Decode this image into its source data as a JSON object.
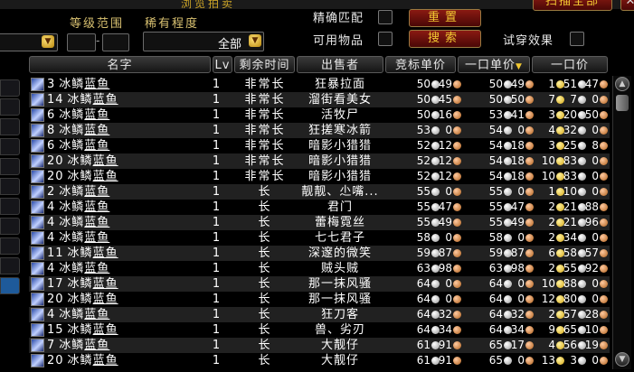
{
  "window": {
    "title": "浏览拍卖",
    "scan_all_label": "扫描全部",
    "close_label": "✕"
  },
  "filters": {
    "level_range_label": "等级范围",
    "rarity_label": "稀有程度",
    "rarity_value": "全部",
    "exact_match_label": "精确匹配",
    "usable_items_label": "可用物品",
    "try_on_label": "试穿效果",
    "reset_label": "重置",
    "search_label": "搜索"
  },
  "columns": {
    "name": "名字",
    "lv": "Lv",
    "time_left": "剩余时间",
    "seller": "出售者",
    "bid_unit": "竞标单价",
    "buyout_unit": "一口单价",
    "buyout": "一口价"
  },
  "item_name_prefix": "冰鳞",
  "item_name_suffix": "蓝鱼",
  "rows": [
    {
      "qty": "3",
      "lv": "1",
      "time": "非常长",
      "seller": "狂暴拉面",
      "bid": {
        "s": "50",
        "c": "49"
      },
      "unit": {
        "s": "50",
        "c": "49"
      },
      "buy": {
        "g": "1",
        "s": "51",
        "c": "47"
      }
    },
    {
      "qty": "14",
      "lv": "1",
      "time": "非常长",
      "seller": "溜街看美女",
      "bid": {
        "s": "50",
        "c": "45"
      },
      "unit": {
        "s": "50",
        "c": "50"
      },
      "buy": {
        "g": "7",
        "s": "7",
        "c": "0"
      }
    },
    {
      "qty": "6",
      "lv": "1",
      "time": "非常长",
      "seller": "活牧尸",
      "bid": {
        "s": "50",
        "c": "16"
      },
      "unit": {
        "s": "53",
        "c": "41"
      },
      "buy": {
        "g": "3",
        "s": "20",
        "c": "50"
      }
    },
    {
      "qty": "8",
      "lv": "1",
      "time": "非常长",
      "seller": "狂搓寒冰箭",
      "bid": {
        "s": "53",
        "c": "0"
      },
      "unit": {
        "s": "54",
        "c": "0"
      },
      "buy": {
        "g": "4",
        "s": "32",
        "c": "0"
      }
    },
    {
      "qty": "6",
      "lv": "1",
      "time": "非常长",
      "seller": "暗影小猎猎",
      "bid": {
        "s": "52",
        "c": "12"
      },
      "unit": {
        "s": "54",
        "c": "18"
      },
      "buy": {
        "g": "3",
        "s": "25",
        "c": "8"
      }
    },
    {
      "qty": "20",
      "lv": "1",
      "time": "非常长",
      "seller": "暗影小猎猎",
      "bid": {
        "s": "52",
        "c": "12"
      },
      "unit": {
        "s": "54",
        "c": "18"
      },
      "buy": {
        "g": "10",
        "s": "83",
        "c": "0"
      }
    },
    {
      "qty": "20",
      "lv": "1",
      "time": "非常长",
      "seller": "暗影小猎猎",
      "bid": {
        "s": "52",
        "c": "12"
      },
      "unit": {
        "s": "54",
        "c": "18"
      },
      "buy": {
        "g": "10",
        "s": "83",
        "c": "0"
      }
    },
    {
      "qty": "2",
      "lv": "1",
      "time": "长",
      "seller": "靓靓、尐嘴...",
      "bid": {
        "s": "55",
        "c": "0"
      },
      "unit": {
        "s": "55",
        "c": "0"
      },
      "buy": {
        "g": "1",
        "s": "10",
        "c": "0"
      }
    },
    {
      "qty": "4",
      "lv": "1",
      "time": "长",
      "seller": "君门",
      "bid": {
        "s": "55",
        "c": "47"
      },
      "unit": {
        "s": "55",
        "c": "47"
      },
      "buy": {
        "g": "2",
        "s": "21",
        "c": "88"
      }
    },
    {
      "qty": "4",
      "lv": "1",
      "time": "长",
      "seller": "蕾梅霓丝",
      "bid": {
        "s": "55",
        "c": "49"
      },
      "unit": {
        "s": "55",
        "c": "49"
      },
      "buy": {
        "g": "2",
        "s": "21",
        "c": "96"
      }
    },
    {
      "qty": "4",
      "lv": "1",
      "time": "长",
      "seller": "七七君子",
      "bid": {
        "s": "58",
        "c": "0"
      },
      "unit": {
        "s": "58",
        "c": "0"
      },
      "buy": {
        "g": "2",
        "s": "34",
        "c": "0"
      }
    },
    {
      "qty": "11",
      "lv": "1",
      "time": "长",
      "seller": "深邃的微笑",
      "bid": {
        "s": "59",
        "c": "87"
      },
      "unit": {
        "s": "59",
        "c": "87"
      },
      "buy": {
        "g": "6",
        "s": "58",
        "c": "57"
      }
    },
    {
      "qty": "4",
      "lv": "1",
      "time": "长",
      "seller": "贼头贼",
      "bid": {
        "s": "63",
        "c": "98"
      },
      "unit": {
        "s": "63",
        "c": "98"
      },
      "buy": {
        "g": "2",
        "s": "55",
        "c": "92"
      }
    },
    {
      "qty": "17",
      "lv": "1",
      "time": "长",
      "seller": "那一抹风骚",
      "bid": {
        "s": "64",
        "c": "0"
      },
      "unit": {
        "s": "64",
        "c": "0"
      },
      "buy": {
        "g": "10",
        "s": "88",
        "c": "0"
      }
    },
    {
      "qty": "20",
      "lv": "1",
      "time": "长",
      "seller": "那一抹风骚",
      "bid": {
        "s": "64",
        "c": "0"
      },
      "unit": {
        "s": "64",
        "c": "0"
      },
      "buy": {
        "g": "12",
        "s": "80",
        "c": "0"
      }
    },
    {
      "qty": "4",
      "lv": "1",
      "time": "长",
      "seller": "狂刀客",
      "bid": {
        "s": "64",
        "c": "32"
      },
      "unit": {
        "s": "64",
        "c": "32"
      },
      "buy": {
        "g": "2",
        "s": "57",
        "c": "28"
      }
    },
    {
      "qty": "15",
      "lv": "1",
      "time": "长",
      "seller": "兽、劣刃",
      "bid": {
        "s": "64",
        "c": "34"
      },
      "unit": {
        "s": "64",
        "c": "34"
      },
      "buy": {
        "g": "9",
        "s": "65",
        "c": "10"
      }
    },
    {
      "qty": "7",
      "lv": "1",
      "time": "长",
      "seller": "大靓仔",
      "bid": {
        "s": "61",
        "c": "91"
      },
      "unit": {
        "s": "65",
        "c": "17"
      },
      "buy": {
        "g": "4",
        "s": "56",
        "c": "19"
      }
    },
    {
      "qty": "20",
      "lv": "1",
      "time": "长",
      "seller": "大靓仔",
      "bid": {
        "s": "61",
        "c": "91"
      },
      "unit": {
        "s": "65",
        "c": "0"
      },
      "buy": {
        "g": "13",
        "s": "3",
        "c": "0"
      }
    }
  ]
}
